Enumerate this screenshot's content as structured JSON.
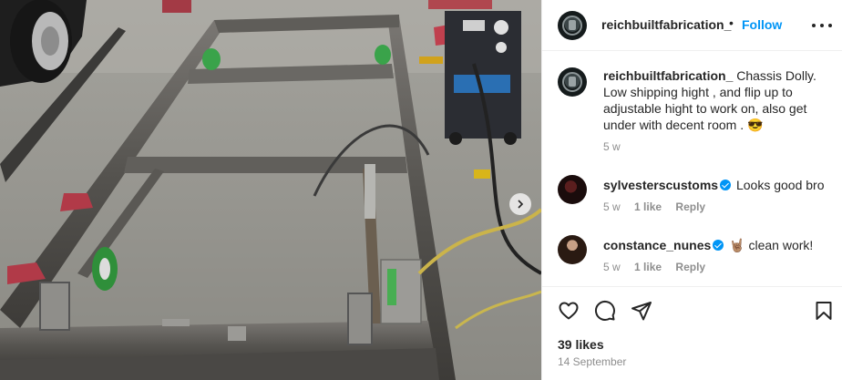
{
  "post": {
    "username": "reichbuiltfabrication_",
    "dot": "•",
    "follow_label": "Follow",
    "more_icon": "more-horizontal-icon"
  },
  "comments": [
    {
      "username": "reichbuiltfabrication_",
      "text": "Chassis Dolly. Low shipping hight , and flip up to adjustable hight to work on, also get under with decent room . 😎",
      "time": "5 w"
    },
    {
      "username": "sylvesterscustoms",
      "verified": true,
      "text": "Looks good bro",
      "time": "5 w",
      "likes": "1 like",
      "reply_label": "Reply"
    },
    {
      "username": "constance_nunes",
      "verified": true,
      "text": "🤘🏽 clean work!",
      "time": "5 w",
      "likes": "1 like",
      "reply_label": "Reply"
    }
  ],
  "footer": {
    "likes": "39 likes",
    "date": "14 September"
  },
  "colors": {
    "link_blue": "#0095f6",
    "muted": "#8e8e8e",
    "text": "#262626",
    "divider": "#efefef"
  },
  "icons": [
    "heart-icon",
    "comment-icon",
    "share-icon",
    "bookmark-icon",
    "chevron-right-icon"
  ]
}
